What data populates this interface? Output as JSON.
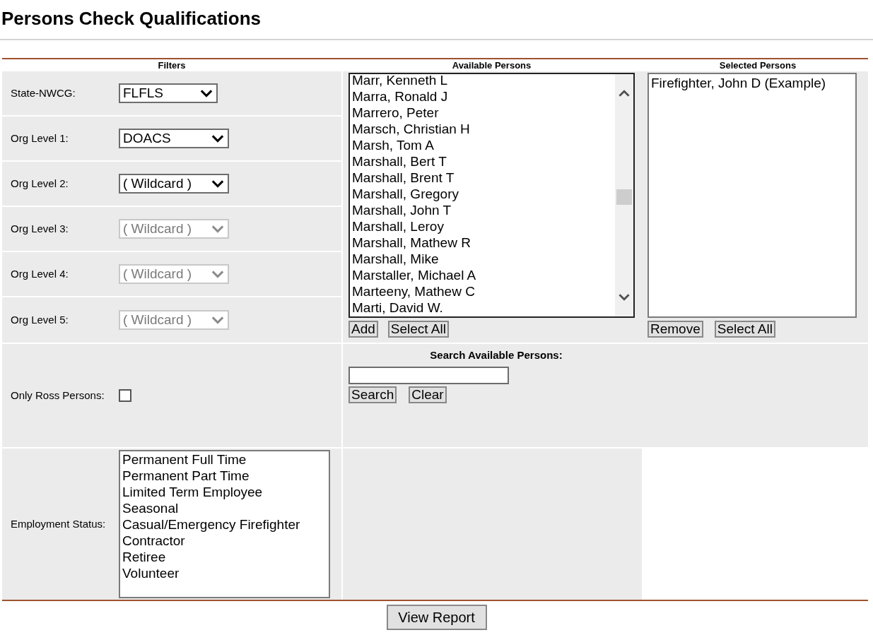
{
  "title": "Persons Check Qualifications",
  "columns": [
    "Filters",
    "Available Persons",
    "Selected Persons"
  ],
  "filters": [
    {
      "label": "State-NWCG:",
      "value": "FLFLS",
      "disabled": false
    },
    {
      "label": "Org Level 1:",
      "value": "DOACS",
      "disabled": false
    },
    {
      "label": "Org Level 2:",
      "value": "( Wildcard )",
      "disabled": false
    },
    {
      "label": "Org Level 3:",
      "value": "( Wildcard )",
      "disabled": true
    },
    {
      "label": "Org Level 4:",
      "value": "( Wildcard )",
      "disabled": true
    },
    {
      "label": "Org Level 5:",
      "value": "( Wildcard )",
      "disabled": true
    }
  ],
  "available_persons": {
    "items": [
      "Marr, Kenneth L",
      "Marra, Ronald J",
      "Marrero, Peter",
      "Marsch, Christian H",
      "Marsh, Tom A",
      "Marshall, Bert T",
      "Marshall, Brent T",
      "Marshall, Gregory",
      "Marshall, John T",
      "Marshall, Leroy",
      "Marshall, Mathew R",
      "Marshall, Mike",
      "Marstaller, Michael A",
      "Marteeny, Mathew C",
      "Marti, David W."
    ],
    "buttons": [
      "Add",
      "Select All"
    ]
  },
  "selected_persons": {
    "items": [
      "Firefighter, John D (Example)"
    ],
    "buttons": [
      "Remove",
      "Select All"
    ]
  },
  "search": {
    "label": "Search Available Persons:",
    "buttons": [
      "Search",
      "Clear"
    ]
  },
  "only_ross": {
    "label": "Only Ross Persons:",
    "checked": false
  },
  "employment_status": {
    "label": "Employment Status:",
    "options": [
      {
        "label": "Permanent Full Time",
        "selected": false
      },
      {
        "label": "Permanent Part Time",
        "selected": false
      },
      {
        "label": "Limited Term Employee",
        "selected": false
      },
      {
        "label": "Seasonal",
        "selected": false
      },
      {
        "label": "Casual/Emergency Firefighter",
        "selected": false
      },
      {
        "label": "Contractor",
        "selected": false
      },
      {
        "label": "Retiree",
        "selected": false
      },
      {
        "label": "Volunteer",
        "selected": false
      }
    ]
  },
  "view_report": "View Report"
}
